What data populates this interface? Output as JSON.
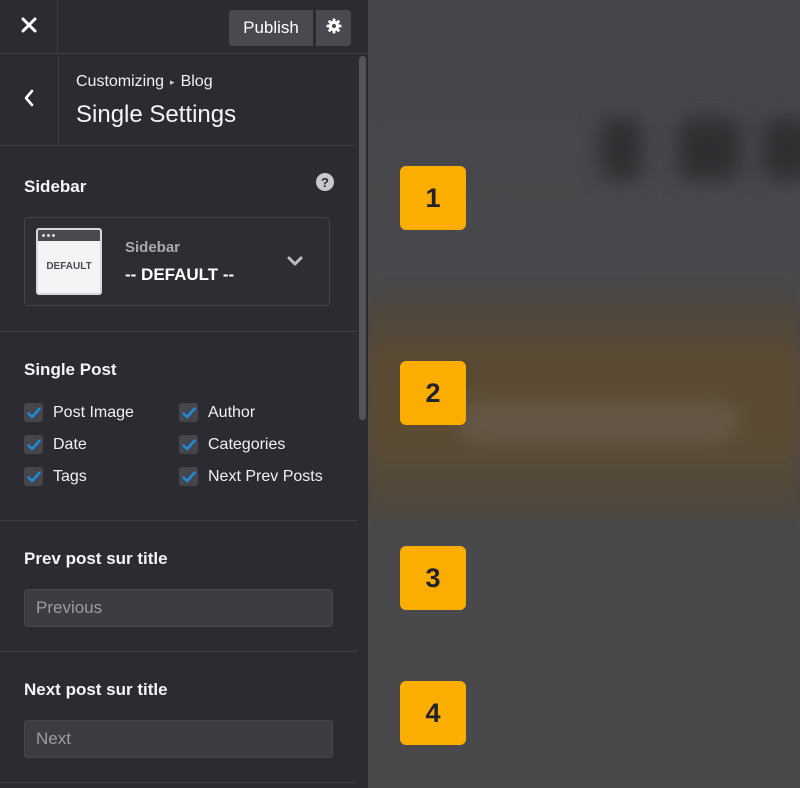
{
  "topbar": {
    "publish_label": "Publish"
  },
  "header": {
    "breadcrumb_root": "Customizing",
    "breadcrumb_separator": "▸",
    "breadcrumb_current": "Blog",
    "title": "Single Settings"
  },
  "sidebar_section": {
    "label": "Sidebar",
    "help_glyph": "?",
    "select_caption": "Sidebar",
    "select_value": "-- DEFAULT --",
    "thumbnail_label": "DEFAULT"
  },
  "single_post": {
    "label": "Single Post",
    "options": [
      {
        "label": "Post Image",
        "checked": true
      },
      {
        "label": "Author",
        "checked": true
      },
      {
        "label": "Date",
        "checked": true
      },
      {
        "label": "Categories",
        "checked": true
      },
      {
        "label": "Tags",
        "checked": true
      },
      {
        "label": "Next Prev Posts",
        "checked": true
      }
    ]
  },
  "prev_title": {
    "label": "Prev post sur title",
    "placeholder": "Previous"
  },
  "next_title": {
    "label": "Next post sur title",
    "placeholder": "Next"
  },
  "preview": {
    "badges": [
      "1",
      "2",
      "3",
      "4"
    ]
  },
  "colors": {
    "panel_bg": "#2c2b31",
    "accent_check": "#1e8cd4",
    "badge": "#fcae00"
  },
  "icons": {
    "close": "close-icon",
    "settings": "gear-icon",
    "back": "chevron-left-icon",
    "help": "help-icon",
    "dropdown": "chevron-down-icon",
    "check": "checkmark-icon"
  }
}
